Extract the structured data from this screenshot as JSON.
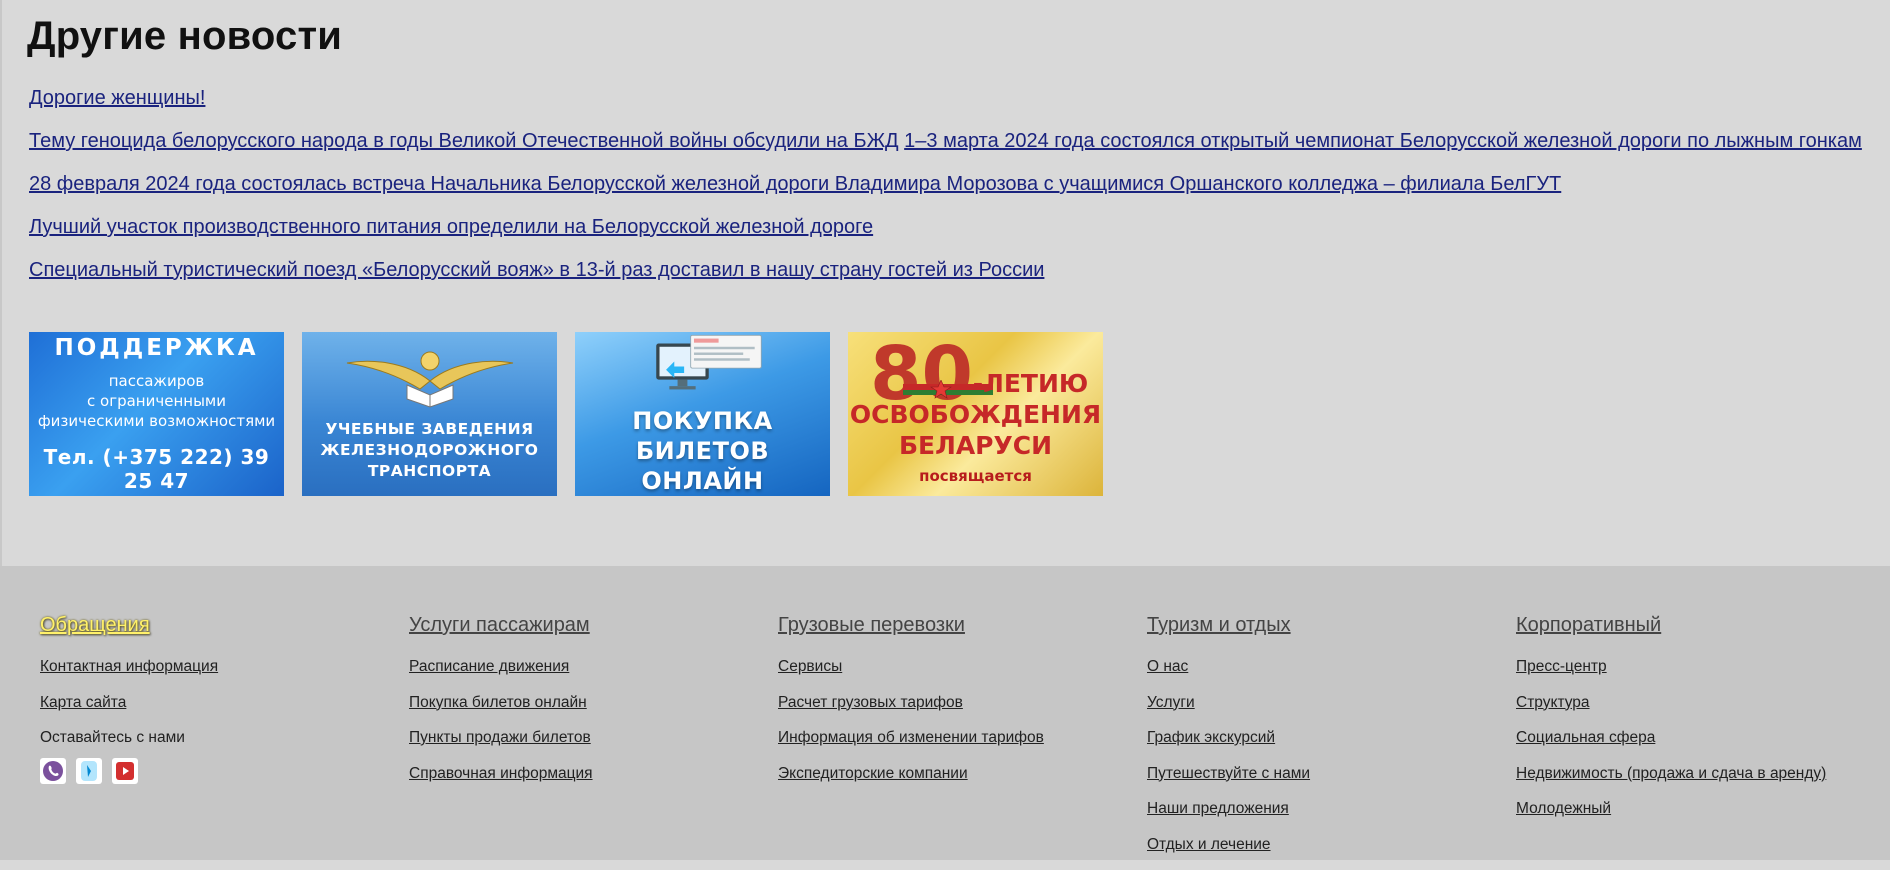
{
  "page": {
    "title": "Другие новости"
  },
  "news": [
    {
      "text": "Дорогие женщины!"
    },
    {
      "text": "Тему геноцида белорусского народа в годы Великой Отечественной войны обсудили на БЖД",
      "text2": "1–3 марта 2024 года состоялся открытый чемпионат Белорусской железной дороги по лыжным гонкам"
    },
    {
      "text": "28 февраля 2024 года состоялась встреча Начальника Белорусской железной дороги Владимира Морозова с учащимися Оршанского колледжа – филиала БелГУТ"
    },
    {
      "text": "Лучший участок производственного питания определили на Белорусской железной дороге"
    },
    {
      "text": "Специальный туристический поезд «Белорусский вояж» в 13-й раз доставил в нашу страну гостей из России"
    }
  ],
  "banners": {
    "support": {
      "title": "ПОДДЕРЖКА",
      "line1": "пассажиров",
      "line2": "с ограниченными",
      "line3": "физическими возможностями",
      "phone": "Тел. (+375 222) 39 25 47"
    },
    "education": {
      "line1": "УЧЕБНЫЕ ЗАВЕДЕНИЯ",
      "line2": "ЖЕЛЕЗНОДОРОЖНОГО",
      "line3": "ТРАНСПОРТА"
    },
    "tickets": {
      "line1": "ПОКУПКА БИЛЕТОВ",
      "line2": "ОНЛАЙН"
    },
    "anniversary": {
      "number": "80",
      "line1": "-ЛЕТИЮ",
      "line2": "ОСВОБОЖДЕНИЯ",
      "line3": "БЕЛАРУСИ",
      "line4": "посвящается"
    }
  },
  "footer": {
    "columns": [
      {
        "title": "Обращения",
        "items": [
          "Контактная информация",
          "Карта сайта"
        ],
        "static": "Оставайтесь с нами"
      },
      {
        "title": "Услуги пассажирам",
        "items": [
          "Расписание движения",
          "Покупка билетов онлайн",
          "Пункты продажи билетов",
          "Справочная информация"
        ]
      },
      {
        "title": "Грузовые перевозки",
        "items": [
          "Сервисы",
          "Расчет грузовых тарифов",
          "Информация об изменении тарифов",
          "Экспедиторские компании"
        ]
      },
      {
        "title": "Туризм и отдых",
        "items": [
          "О нас",
          "Услуги",
          "График экскурсий",
          "Путешествуйте с нами",
          "Наши предложения",
          "Отдых и лечение"
        ]
      },
      {
        "title": "Корпоративный",
        "items": [
          "Пресс-центр",
          "Структура",
          "Социальная сфера",
          "Недвижимость (продажа и сдача в аренду)",
          "Молодежный"
        ]
      }
    ],
    "social_icons": [
      "viber-icon",
      "telegram-icon",
      "youtube-icon"
    ]
  },
  "colors": {
    "link": "#1a237e",
    "footer_bg": "#c6c6c6",
    "page_bg": "#d9d9d9",
    "highlight": "#fff16a"
  }
}
